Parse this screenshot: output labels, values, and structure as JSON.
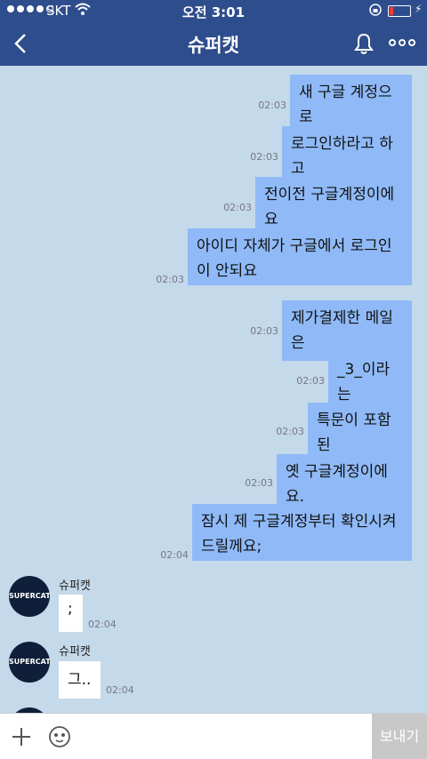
{
  "status_bar": {
    "carrier": "SKT",
    "time": "오전 3:01",
    "signal_icon": "signal-dots-icon",
    "wifi_icon": "wifi-icon",
    "lock_icon": "orientation-lock-icon",
    "battery_icon": "battery-icon",
    "charging_icon": "bolt-icon",
    "battery_color": "#ff3b30"
  },
  "header": {
    "title": "슈퍼캣",
    "back_icon": "chevron-left-icon",
    "bell_icon": "bell-icon",
    "more_icon": "more-dots-icon"
  },
  "messages_out": [
    {
      "text": "새 구글 계정으로",
      "time": "02:03"
    },
    {
      "text": "로그인하라고 하고",
      "time": "02:03"
    },
    {
      "text": "전이전 구글계정이에요",
      "time": "02:03"
    },
    {
      "text": "아이디 자체가 구글에서 로그인이 안되요",
      "time": "02:03"
    },
    {
      "text": "제가결제한 메일은",
      "time": "02:03"
    },
    {
      "text": "_3_이라는",
      "time": "02:03"
    },
    {
      "text": "특문이 포함된",
      "time": "02:03"
    },
    {
      "text": "옛 구글계정이에요.",
      "time": "02:03"
    },
    {
      "text": "잠시 제 구글계정부터 확인시켜드릴께요;",
      "time": "02:04"
    }
  ],
  "messages_in": [
    {
      "sender": "슈퍼캣",
      "avatar": "SUPERCAT",
      "text": ";",
      "time": "02:04"
    },
    {
      "sender": "슈퍼캣",
      "avatar": "SUPERCAT",
      "text": "그..",
      "time": "02:04"
    }
  ],
  "input_bar": {
    "send_label": "보내기",
    "plus_icon": "plus-icon",
    "emoji_icon": "emoji-icon"
  },
  "colors": {
    "header": "#2e4d8c",
    "background": "#c4d9ea",
    "outgoing_bubble": "#8fbaf7",
    "incoming_bubble": "#ffffff",
    "send_button": "#c8c8c8"
  }
}
